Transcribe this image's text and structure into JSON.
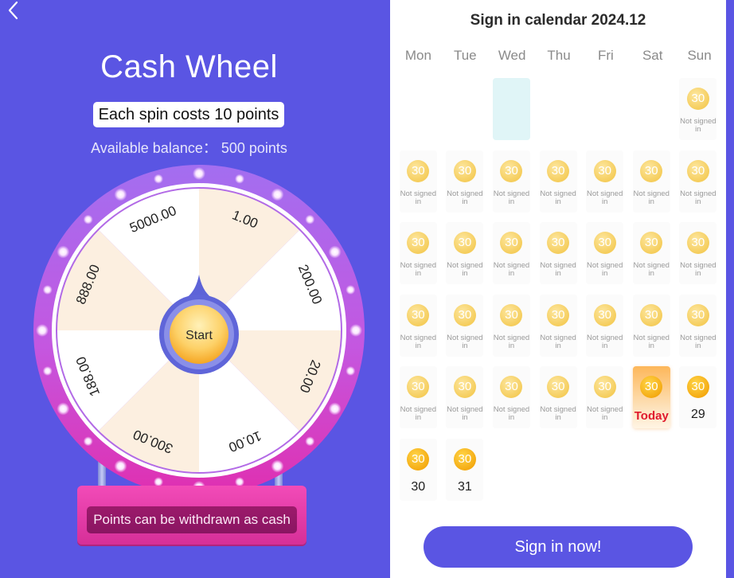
{
  "header": {
    "back_icon": "chevron-left-icon",
    "title": "Cash Wheel"
  },
  "wheel": {
    "cost_label": "Each spin costs 10 points",
    "balance_label": "Available balance： 500 points",
    "start_label": "Start",
    "prizes": [
      "1.00",
      "200.00",
      "20.00",
      "10.00",
      "300.00",
      "188.00",
      "888.00",
      "5000.00"
    ],
    "slice_colors": [
      "#fcefe0",
      "#ffffff"
    ],
    "stand_text": "Points can be withdrawn as cash"
  },
  "calendar": {
    "title": "Sign in calendar 2024.12",
    "weekdays": [
      "Mon",
      "Tue",
      "Wed",
      "Thu",
      "Fri",
      "Sat",
      "Sun"
    ],
    "coin_value": "30",
    "not_signed_text": "Not signed in",
    "today_label": "Today",
    "cells": [
      {
        "type": "empty"
      },
      {
        "type": "empty"
      },
      {
        "type": "highlight"
      },
      {
        "type": "empty"
      },
      {
        "type": "empty"
      },
      {
        "type": "empty"
      },
      {
        "type": "past"
      },
      {
        "type": "past"
      },
      {
        "type": "past"
      },
      {
        "type": "past"
      },
      {
        "type": "past"
      },
      {
        "type": "past"
      },
      {
        "type": "past"
      },
      {
        "type": "past"
      },
      {
        "type": "past"
      },
      {
        "type": "past"
      },
      {
        "type": "past"
      },
      {
        "type": "past"
      },
      {
        "type": "past"
      },
      {
        "type": "past"
      },
      {
        "type": "past"
      },
      {
        "type": "past"
      },
      {
        "type": "past"
      },
      {
        "type": "past"
      },
      {
        "type": "past"
      },
      {
        "type": "past"
      },
      {
        "type": "past"
      },
      {
        "type": "past"
      },
      {
        "type": "past"
      },
      {
        "type": "past"
      },
      {
        "type": "past"
      },
      {
        "type": "past"
      },
      {
        "type": "past"
      },
      {
        "type": "today"
      },
      {
        "type": "future",
        "day": "29"
      },
      {
        "type": "future",
        "day": "30"
      },
      {
        "type": "future",
        "day": "31"
      }
    ],
    "signin_button": "Sign in now!"
  },
  "colors": {
    "primary": "#5a55e3",
    "today_red": "#e0192c",
    "coin": "#f5cd5c"
  }
}
